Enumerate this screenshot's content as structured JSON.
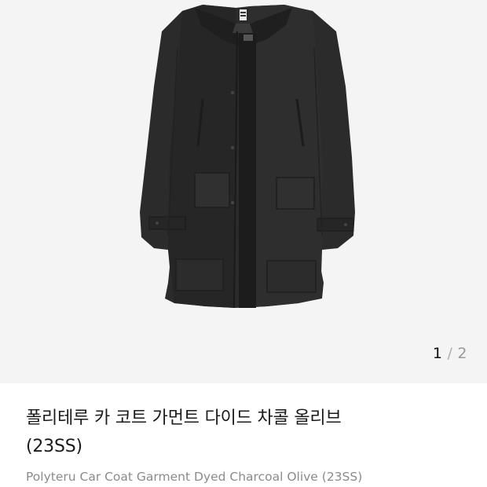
{
  "gallery": {
    "image_alt": "charcoal car coat",
    "pager": {
      "current": "1",
      "separator": "/",
      "total": "2"
    }
  },
  "product": {
    "title_line1": "폴리테루 카 코트 가먼트 다이드 차콜 올리브",
    "title_line2": "(23SS)",
    "subtitle": "Polyteru Car Coat Garment Dyed Charcoal Olive (23SS)"
  },
  "colors": {
    "background": "#f4f4f4",
    "coat": "#2a2a2a",
    "title": "#1a1a1a",
    "subtitle": "#8b8b8b"
  }
}
